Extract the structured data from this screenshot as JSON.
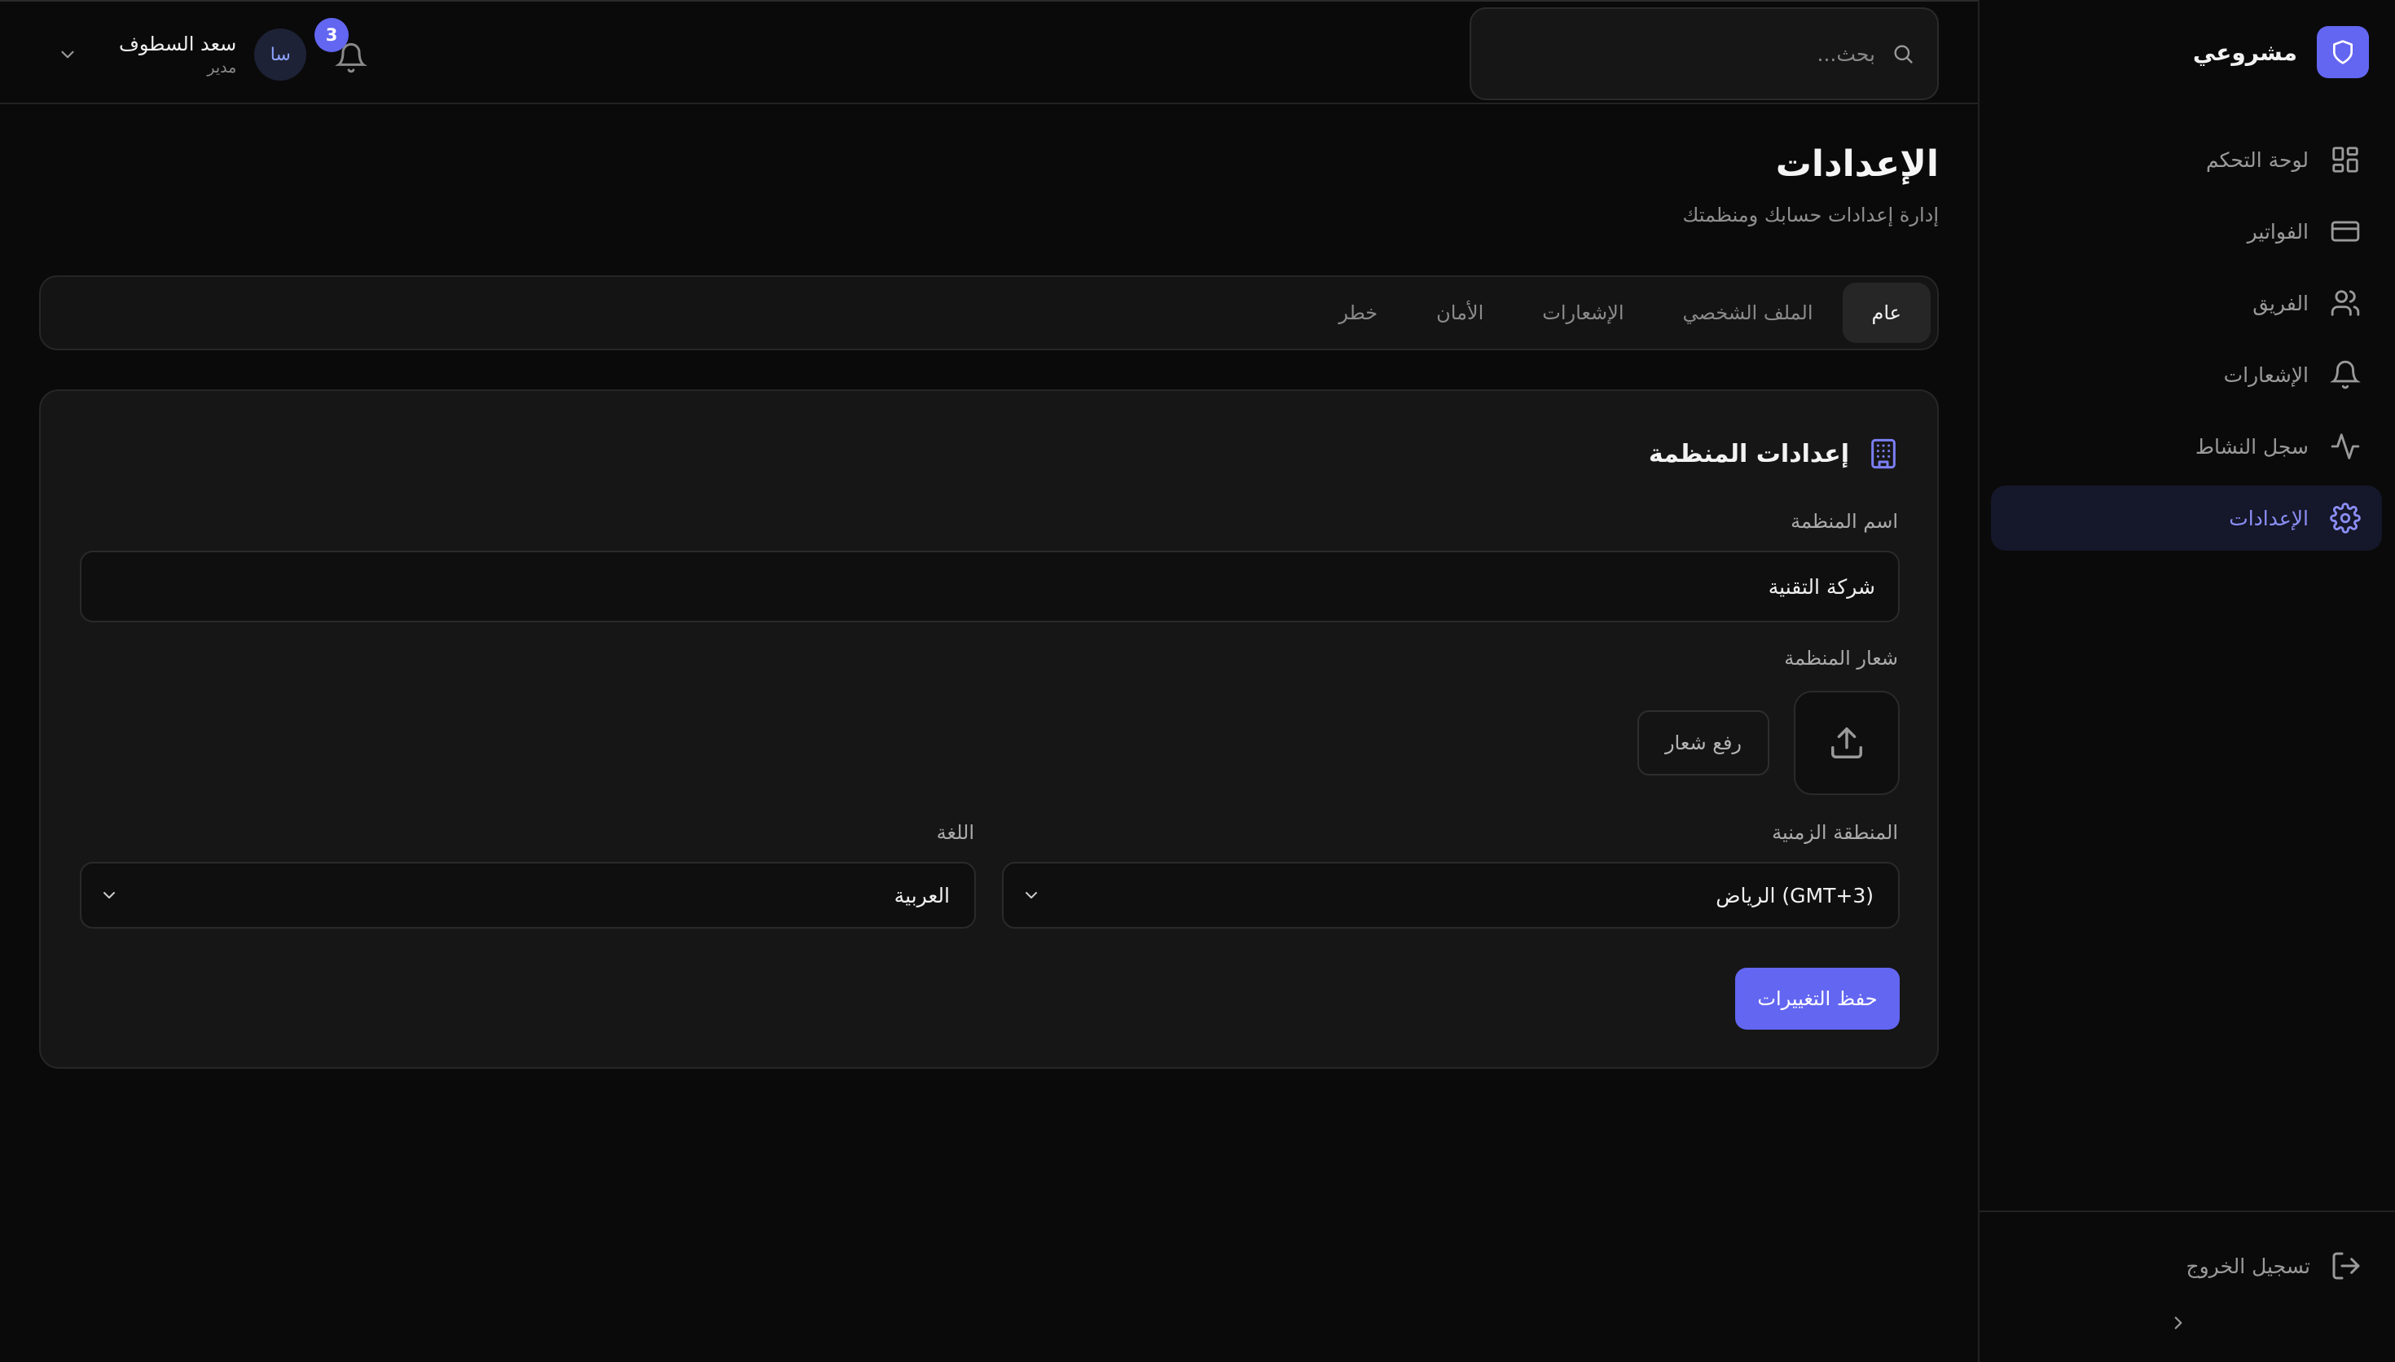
{
  "app": {
    "name": "مشروعي",
    "accent": "#6366f1"
  },
  "sidebar": {
    "items": [
      {
        "label": "لوحة التحكم",
        "icon": "grid-icon"
      },
      {
        "label": "الفواتير",
        "icon": "credit-card-icon"
      },
      {
        "label": "الفريق",
        "icon": "users-icon"
      },
      {
        "label": "الإشعارات",
        "icon": "bell-icon"
      },
      {
        "label": "سجل النشاط",
        "icon": "activity-icon"
      },
      {
        "label": "الإعدادات",
        "icon": "gear-icon",
        "active": true
      }
    ],
    "logout_label": "تسجيل الخروج"
  },
  "header": {
    "search_placeholder": "بحث...",
    "notification_count": "3",
    "user": {
      "initials": "سا",
      "name": "سعد السطوف",
      "role": "مدير"
    }
  },
  "page": {
    "title": "الإعدادات",
    "subtitle": "إدارة إعدادات حسابك ومنظمتك"
  },
  "tabs": [
    "عام",
    "الملف الشخصي",
    "الإشعارات",
    "الأمان",
    "خطر"
  ],
  "active_tab": "عام",
  "org_settings": {
    "title": "إعدادات المنظمة",
    "name_label": "اسم المنظمة",
    "name_value": "شركة التقنية",
    "logo_label": "شعار المنظمة",
    "upload_label": "رفع شعار",
    "timezone_label": "المنطقة الزمنية",
    "timezone_value": "الرياض (GMT+3)",
    "language_label": "اللغة",
    "language_value": "العربية",
    "save_label": "حفظ التغييرات"
  }
}
